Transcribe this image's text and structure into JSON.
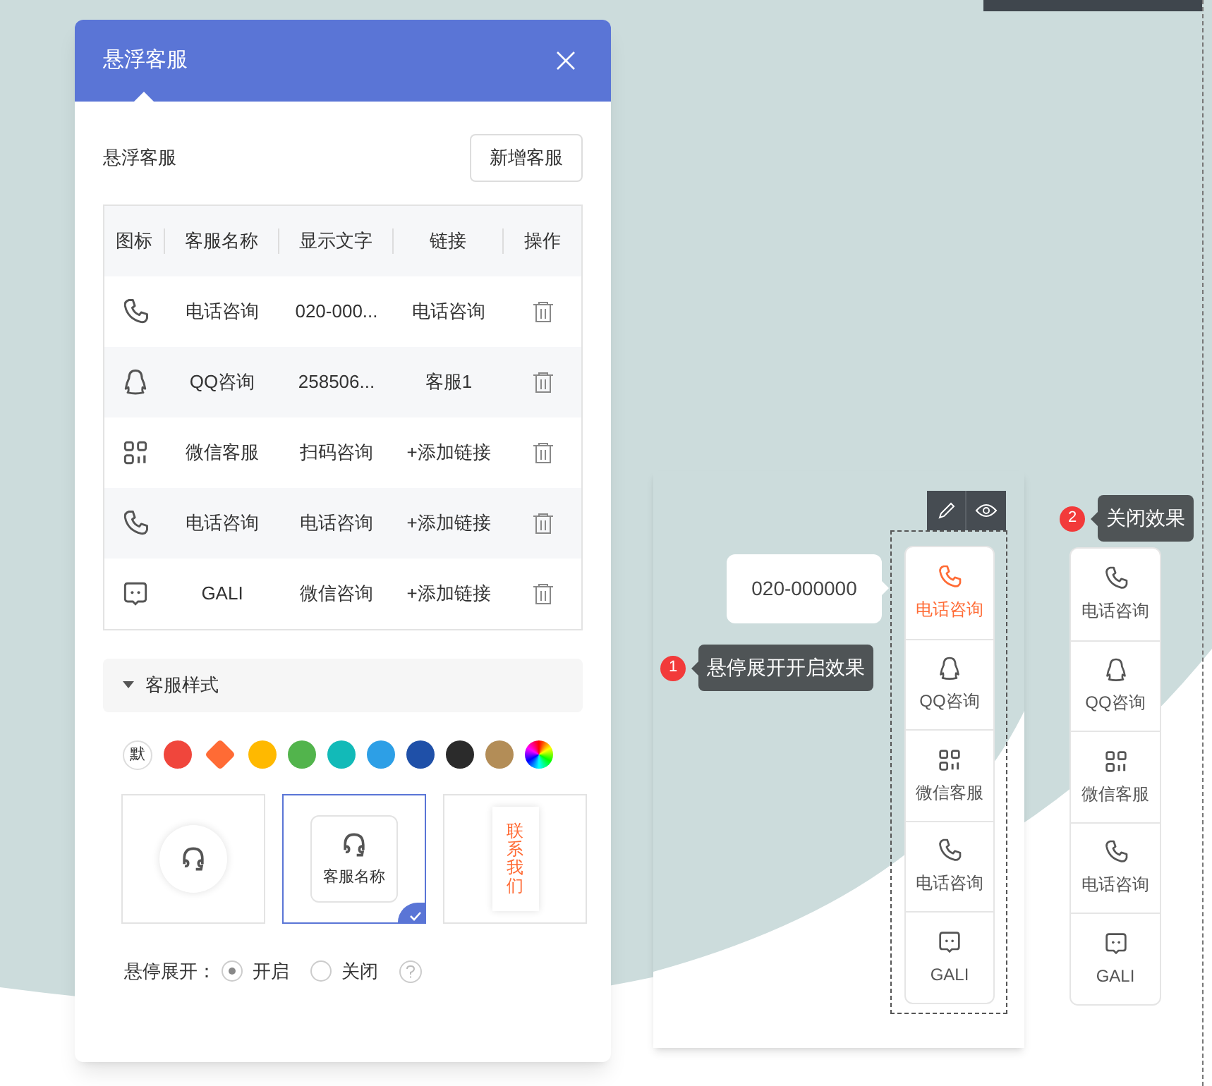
{
  "panel": {
    "title": "悬浮客服",
    "section_label": "悬浮客服",
    "add_button": "新增客服",
    "columns": [
      "图标",
      "客服名称",
      "显示文字",
      "链接",
      "操作"
    ],
    "rows": [
      {
        "kind": "phone",
        "name": "电话咨询",
        "text": "020-000...",
        "link": "电话咨询"
      },
      {
        "kind": "qq",
        "name": "QQ咨询",
        "text": "258506...",
        "link": "客服1"
      },
      {
        "kind": "grid",
        "name": "微信客服",
        "text": "扫码咨询",
        "link": "+添加链接"
      },
      {
        "kind": "phone",
        "name": "电话咨询",
        "text": "电话咨询",
        "link": "+添加链接"
      },
      {
        "kind": "chat",
        "name": "GALI",
        "text": "微信咨询",
        "link": "+添加链接"
      }
    ],
    "style_section": {
      "title": "客服样式",
      "expanded": true
    },
    "colors": [
      {
        "kind": "default",
        "label": "默",
        "selected": false
      },
      {
        "kind": "swatch",
        "color": "#f0463c",
        "selected": false
      },
      {
        "kind": "swatch",
        "color": "#ff6b35",
        "selected": true
      },
      {
        "kind": "swatch",
        "color": "#ffb900",
        "selected": false
      },
      {
        "kind": "swatch",
        "color": "#52b44c",
        "selected": false
      },
      {
        "kind": "swatch",
        "color": "#12bab8",
        "selected": false
      },
      {
        "kind": "swatch",
        "color": "#2d9fe6",
        "selected": false
      },
      {
        "kind": "swatch",
        "color": "#1f50a8",
        "selected": false
      },
      {
        "kind": "swatch",
        "color": "#2b2b2b",
        "selected": false
      },
      {
        "kind": "swatch",
        "color": "#b38d57",
        "selected": false
      },
      {
        "kind": "rainbow",
        "selected": false
      }
    ],
    "styles": [
      {
        "kind": "circle",
        "selected": false
      },
      {
        "kind": "card",
        "label": "客服名称",
        "selected": true
      },
      {
        "kind": "vertical",
        "label": "联系我们",
        "selected": false
      }
    ],
    "hover_expand": {
      "label": "悬停展开：",
      "options": [
        {
          "label": "开启",
          "selected": true
        },
        {
          "label": "关闭",
          "selected": false
        }
      ]
    }
  },
  "preview_open": {
    "tooltip": "020-000000",
    "badge": "1",
    "caption": "悬停展开开启效果",
    "items": [
      {
        "kind": "phone",
        "label": "电话咨询",
        "active": true
      },
      {
        "kind": "qq",
        "label": "QQ咨询",
        "active": false
      },
      {
        "kind": "grid",
        "label": "微信客服",
        "active": false
      },
      {
        "kind": "phone",
        "label": "电话咨询",
        "active": false
      },
      {
        "kind": "chat",
        "label": "GALI",
        "active": false
      }
    ]
  },
  "preview_closed": {
    "badge": "2",
    "caption": "关闭效果",
    "items": [
      {
        "kind": "phone",
        "label": "电话咨询",
        "active": false
      },
      {
        "kind": "qq",
        "label": "QQ咨询",
        "active": false
      },
      {
        "kind": "grid",
        "label": "微信客服",
        "active": false
      },
      {
        "kind": "phone",
        "label": "电话咨询",
        "active": false
      },
      {
        "kind": "chat",
        "label": "GALI",
        "active": false
      }
    ]
  }
}
